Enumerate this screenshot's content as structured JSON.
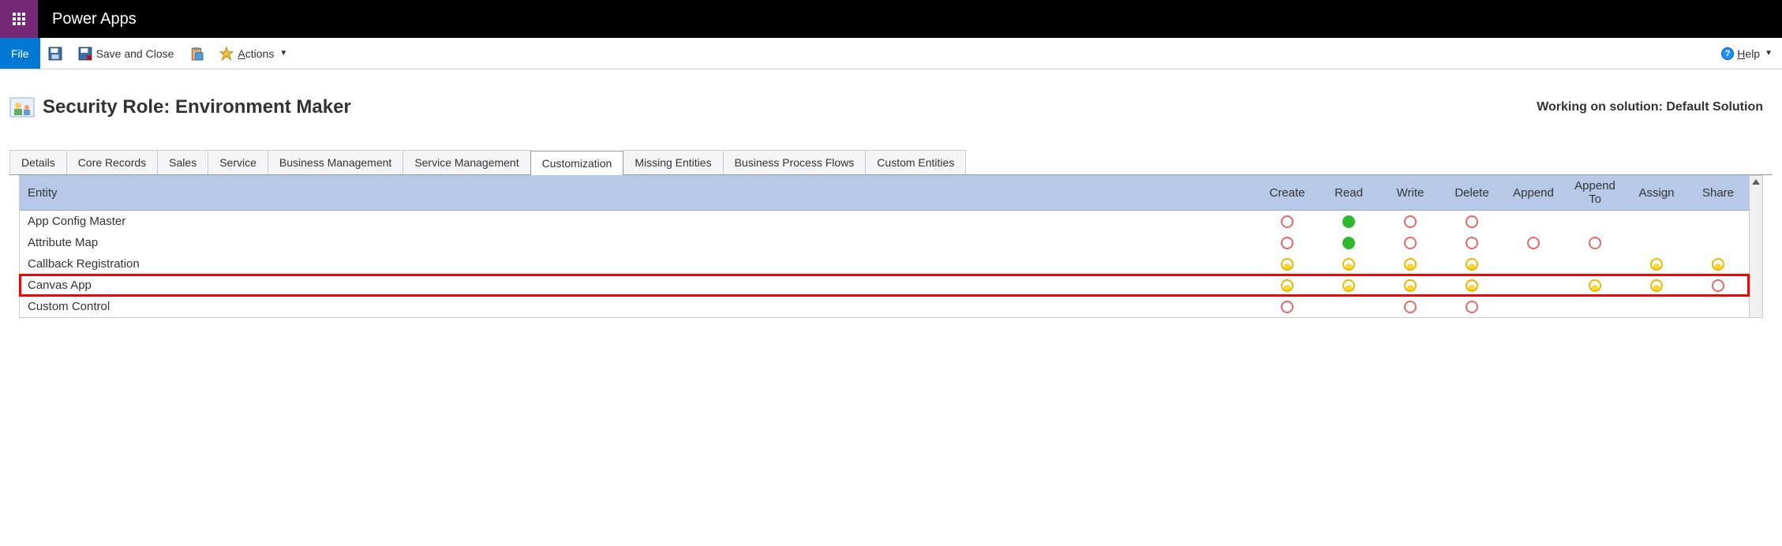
{
  "app_title": "Power Apps",
  "ribbon": {
    "file": "File",
    "save_close": "Save and Close",
    "actions": "Actions",
    "help": "Help"
  },
  "page": {
    "title": "Security Role: Environment Maker",
    "solution": "Working on solution: Default Solution"
  },
  "tabs": [
    "Details",
    "Core Records",
    "Sales",
    "Service",
    "Business Management",
    "Service Management",
    "Customization",
    "Missing Entities",
    "Business Process Flows",
    "Custom Entities"
  ],
  "active_tab": 6,
  "columns": [
    "Entity",
    "Create",
    "Read",
    "Write",
    "Delete",
    "Append",
    "Append To",
    "Assign",
    "Share"
  ],
  "rows": [
    {
      "name": "App Config Master",
      "perms": [
        "none",
        "full",
        "none",
        "none",
        "",
        "",
        "",
        ""
      ]
    },
    {
      "name": "Attribute Map",
      "perms": [
        "none",
        "full",
        "none",
        "none",
        "none",
        "none",
        "",
        ""
      ]
    },
    {
      "name": "Callback Registration",
      "perms": [
        "user",
        "user",
        "user",
        "user",
        "",
        "",
        "user",
        "user"
      ]
    },
    {
      "name": "Canvas App",
      "perms": [
        "user",
        "user",
        "user",
        "user",
        "",
        "user",
        "user",
        "none"
      ],
      "highlight": true
    },
    {
      "name": "Custom Control",
      "perms": [
        "none",
        "",
        "none",
        "none",
        "",
        "",
        "",
        ""
      ]
    }
  ]
}
